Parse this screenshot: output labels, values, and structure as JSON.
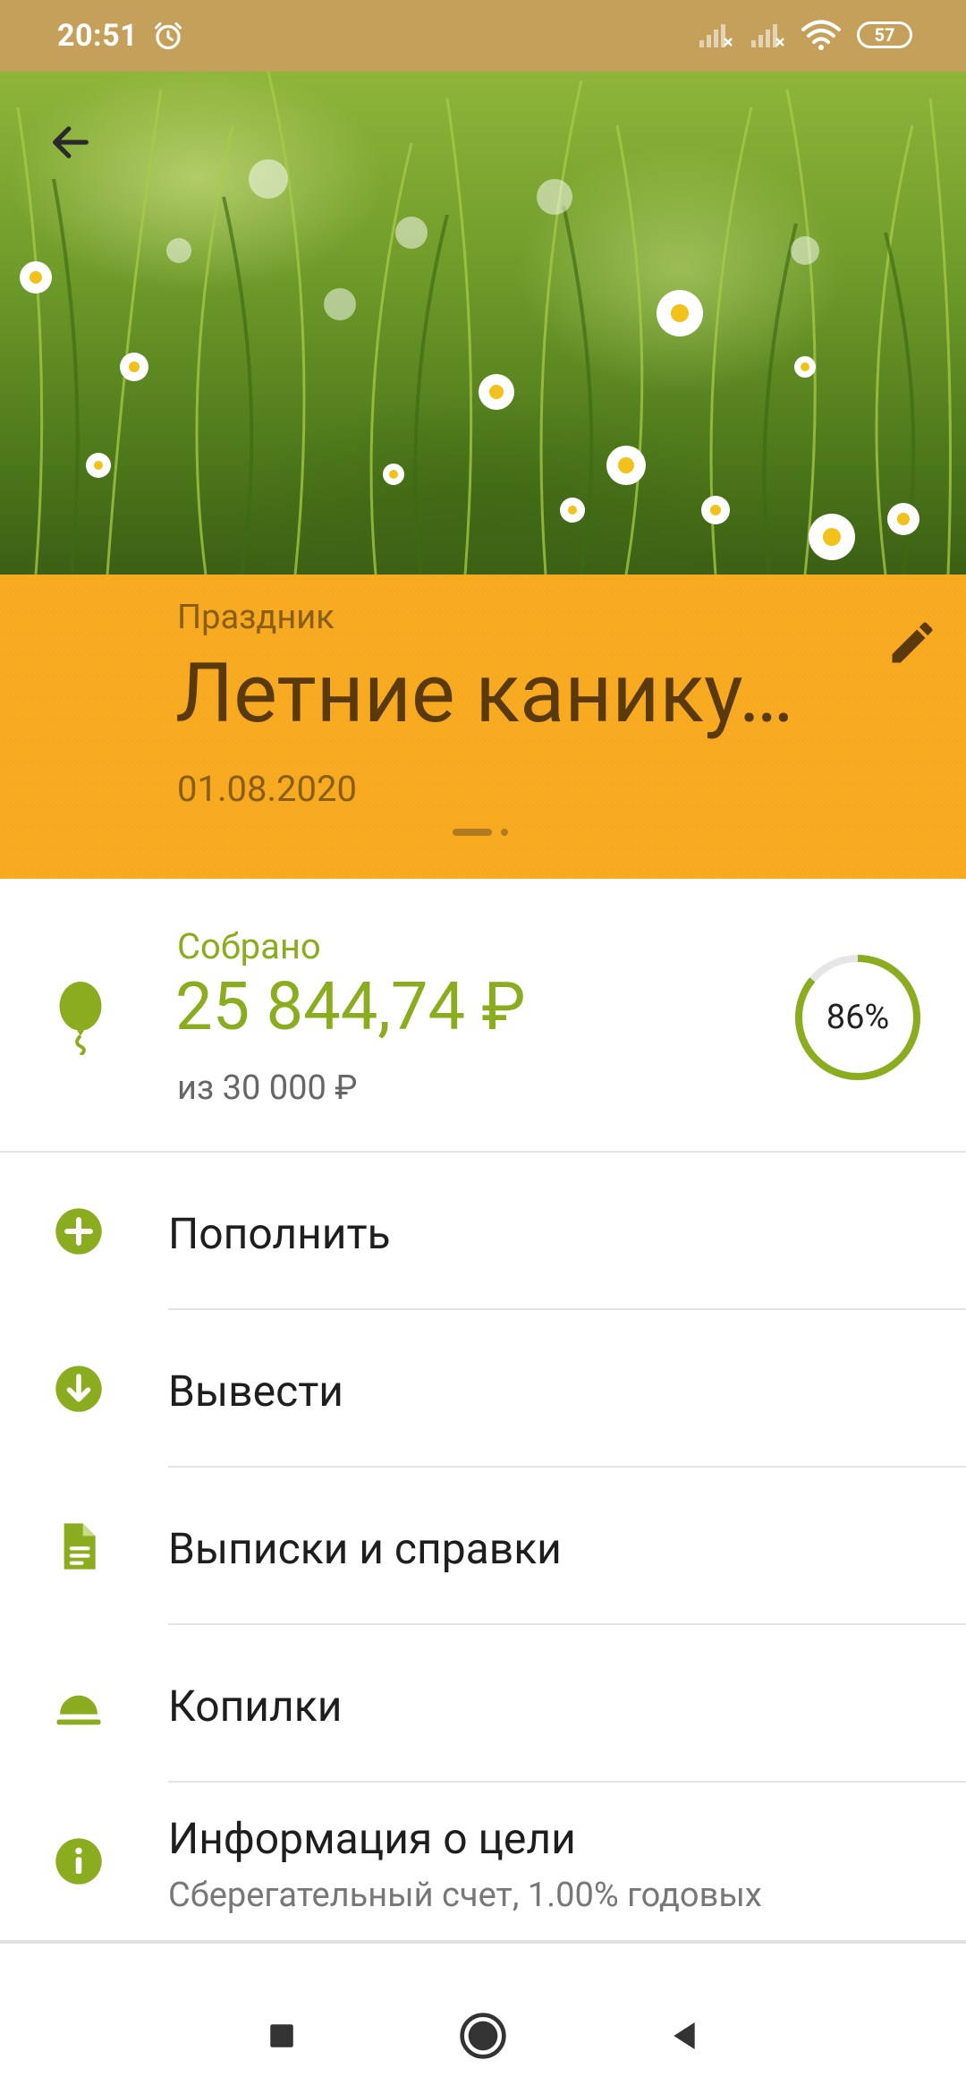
{
  "status_bar": {
    "time": "20:51",
    "battery": "57",
    "icons": [
      "alarm-icon",
      "signal-icon",
      "signal-icon",
      "wifi-icon",
      "battery-icon"
    ]
  },
  "header": {
    "back_icon": "arrow-left-icon",
    "category": "Праздник",
    "title": "Летние канику…",
    "date": "01.08.2020",
    "edit_icon": "pencil-icon",
    "accent_color": "#f7a91f"
  },
  "collected": {
    "label": "Собрано",
    "amount": "25 844,74 ₽",
    "target": "из 30 000 ₽",
    "progress_percent": 86,
    "progress_text": "86%",
    "icon": "balloon-icon",
    "accent_color": "#8aac1e"
  },
  "menu": {
    "items": [
      {
        "label": "Пополнить",
        "icon": "plus-circle-icon"
      },
      {
        "label": "Вывести",
        "icon": "arrow-down-circle-icon"
      },
      {
        "label": "Выписки и справки",
        "icon": "document-icon"
      },
      {
        "label": "Копилки",
        "icon": "piggy-bank-icon"
      },
      {
        "label": "Информация о цели",
        "sub": "Сберегательный счет, 1.00% годовых",
        "icon": "info-icon"
      }
    ]
  },
  "navbar": {
    "icons": [
      "recents-square-icon",
      "home-circle-icon",
      "back-triangle-icon"
    ]
  }
}
